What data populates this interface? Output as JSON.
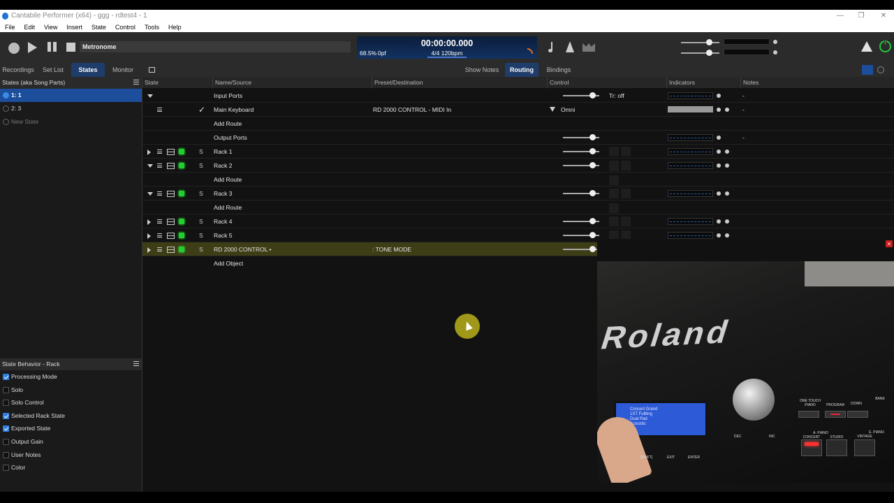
{
  "window": {
    "title": "Cantabile Performer (x64) - ggg - rdtest4 - 1"
  },
  "menu": [
    "File",
    "Edit",
    "View",
    "Insert",
    "State",
    "Control",
    "Tools",
    "Help"
  ],
  "toolbar": {
    "metronome_label": "Metronome",
    "transport": {
      "time": "00:00:00.000",
      "speed": "68.5%",
      "pitch": "0pf",
      "tempo": "4/4 120bpm"
    }
  },
  "left_tabs": [
    "Recordings",
    "Set List",
    "States",
    "Monitor"
  ],
  "left_tabs_active": "States",
  "view_tabs": [
    "Show Notes",
    "Routing",
    "Bindings"
  ],
  "view_tabs_active": "Routing",
  "states_panel": {
    "title": "States (aka Song Parts)",
    "items": [
      {
        "label": "1: 1",
        "selected": true
      },
      {
        "label": "2: 3",
        "selected": false
      },
      {
        "label": "New State",
        "selected": false
      }
    ]
  },
  "behavior_panel": {
    "title": "State Behavior - Rack",
    "items": [
      {
        "label": "Processing Mode",
        "checked": true
      },
      {
        "label": "Solo",
        "checked": false
      },
      {
        "label": "Solo Control",
        "checked": false
      },
      {
        "label": "Selected Rack State",
        "checked": true
      },
      {
        "label": "Exported State",
        "checked": true
      },
      {
        "label": "Output Gain",
        "checked": false
      },
      {
        "label": "User Notes",
        "checked": false
      },
      {
        "label": "Color",
        "checked": false
      }
    ]
  },
  "columns": [
    "State",
    "Name/Source",
    "Preset/Destination",
    "Control",
    "Indicators",
    "Notes"
  ],
  "rows": [
    {
      "name": "Input Ports",
      "preset": "",
      "control_text": "Tr: off",
      "notes": "-"
    },
    {
      "name": "Main Keyboard",
      "preset": "RD 2000 CONTROL - MIDI In",
      "control_text": "Omni",
      "notes": "-"
    },
    {
      "name": "Add Route",
      "preset": "",
      "control_text": "",
      "notes": ""
    },
    {
      "name": "Output Ports",
      "preset": "",
      "control_text": "",
      "notes": "-"
    },
    {
      "name": "Rack 1",
      "solo": "S",
      "preset": "",
      "control_text": "",
      "notes": ""
    },
    {
      "name": "Rack 2",
      "solo": "S",
      "preset": "",
      "control_text": "",
      "notes": ""
    },
    {
      "name": "Add Route",
      "preset": "",
      "control_text": "",
      "notes": ""
    },
    {
      "name": "Rack 3",
      "solo": "S",
      "preset": "",
      "control_text": "",
      "notes": ""
    },
    {
      "name": "Add Route",
      "preset": "",
      "control_text": "",
      "notes": ""
    },
    {
      "name": "Rack 4",
      "solo": "S",
      "preset": "",
      "control_text": "",
      "notes": ""
    },
    {
      "name": "Rack 5",
      "solo": "S",
      "preset": "",
      "control_text": "",
      "notes": ""
    },
    {
      "name": "RD 2000 CONTROL •",
      "solo": "S",
      "preset": ": TONE MODE",
      "control_text": "",
      "notes": ""
    },
    {
      "name": "Add Object",
      "preset": "",
      "control_text": "",
      "notes": ""
    }
  ],
  "video_overlay": {
    "close_glyph": "×",
    "brand_text": "Roland",
    "buttons": [
      "ONE TOUCH PIANO",
      "PROGRAM",
      "DOWN",
      "BANK",
      "CONCERT",
      "STUDIO",
      "VINTAGE",
      "A. PIANO",
      "E. PIANO",
      "DEC",
      "INC",
      "[SHIFT]",
      "EXIT",
      "ENTER"
    ],
    "screen_lines": [
      "Concert Grand",
      "1ST Fullting",
      "Dual Pad",
      "Acoustic"
    ]
  },
  "colors": {
    "accent": "#1c4e9c",
    "led_green": "#22cc33",
    "highlight_row": "#3d3d16",
    "power": "#22c93a",
    "warning": "#e0e0e0"
  }
}
